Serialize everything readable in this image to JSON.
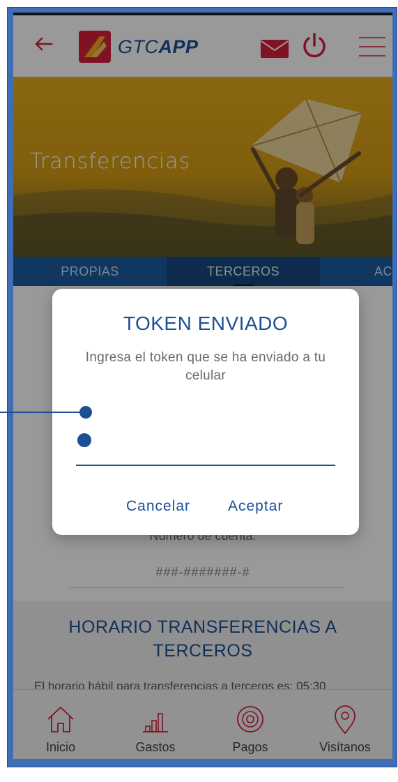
{
  "header": {
    "logo_text_light": "GTC",
    "logo_text_bold": "APP",
    "icons": {
      "back": "arrow-left-icon",
      "mail": "mail-icon",
      "power": "power-icon",
      "menu": "hamburger-menu-icon"
    }
  },
  "hero": {
    "title": "Transferencias"
  },
  "tabs": [
    {
      "label": "PROPIAS",
      "active": false
    },
    {
      "label": "TERCEROS",
      "active": true
    },
    {
      "label": "AC",
      "active": false
    }
  ],
  "account": {
    "label": "Número de cuenta:",
    "value": "###-#######-#"
  },
  "schedule": {
    "title": "HORARIO TRANSFERENCIAS A TERCEROS",
    "text": "El horario hábil para transferencias a terceros es: 05:30"
  },
  "bottom_nav": [
    {
      "label": "Inicio",
      "icon": "home-icon"
    },
    {
      "label": "Gastos",
      "icon": "bar-chart-icon"
    },
    {
      "label": "Pagos",
      "icon": "coin-icon"
    },
    {
      "label": "Visítanos",
      "icon": "location-pin-icon"
    }
  ],
  "dialog": {
    "title": "TOKEN ENVIADO",
    "message": "Ingresa el token que se ha enviado a tu celular",
    "token_value": "",
    "cancel_label": "Cancelar",
    "accept_label": "Aceptar"
  },
  "colors": {
    "brand_blue": "#1c4f94",
    "tab_blue": "#1c5ca0",
    "accent_red": "#d71f3c",
    "frame_blue": "#3f6eb7"
  }
}
